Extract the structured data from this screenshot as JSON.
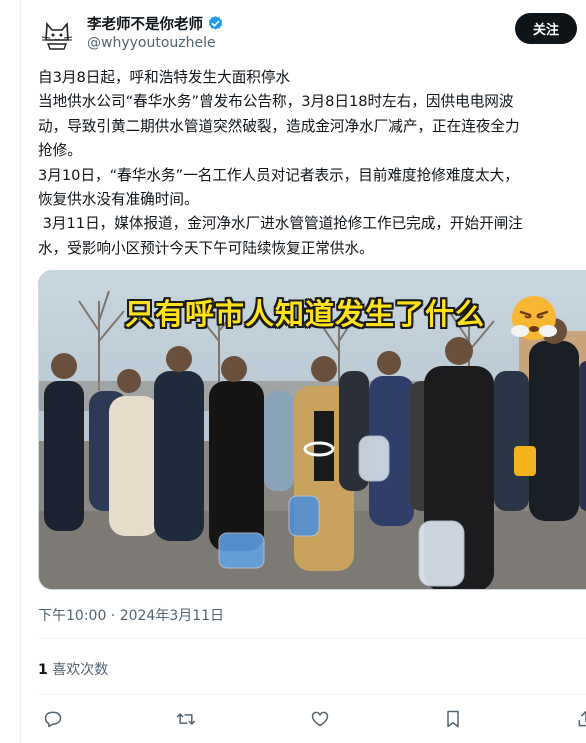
{
  "author": {
    "display_name": "李老师不是你老师",
    "handle": "@whyyoutouzhele",
    "verified_icon": "verified-badge-icon",
    "badge_color": "#1d9bf0"
  },
  "follow_button": {
    "label": "关注"
  },
  "tweet": {
    "lines": [
      "自3月8日起，呼和浩特发生大面积停水",
      "当地供水公司“春华水务”曾发布公告称，3月8日18时左右，因供电电网波",
      "动，导致引黄二期供水管道突然破裂，造成金河净水厂减产，正在连夜全力",
      "抢修。",
      "3月10日，“春华水务”一名工作人员对记者表示，目前难度抢修难度太大，",
      "恢复供水没有准确时间。",
      " 3月11日，媒体报道，金河净水厂进水管管道抢修工作已完成，开始开闸注",
      "水，受影响小区预计今天下午可陆续恢复正常供水。"
    ]
  },
  "media": {
    "caption": "只有呼市人知道发生了什么",
    "emoji": "angry-steam-face-icon",
    "caption_color": "#ffe21a"
  },
  "timestamp": "下午10:00 · 2024年3月11日",
  "likes": {
    "count": "1",
    "label": "喜欢次数"
  },
  "actions": [
    "reply-icon",
    "retweet-icon",
    "like-icon",
    "bookmark-icon",
    "share-icon"
  ]
}
